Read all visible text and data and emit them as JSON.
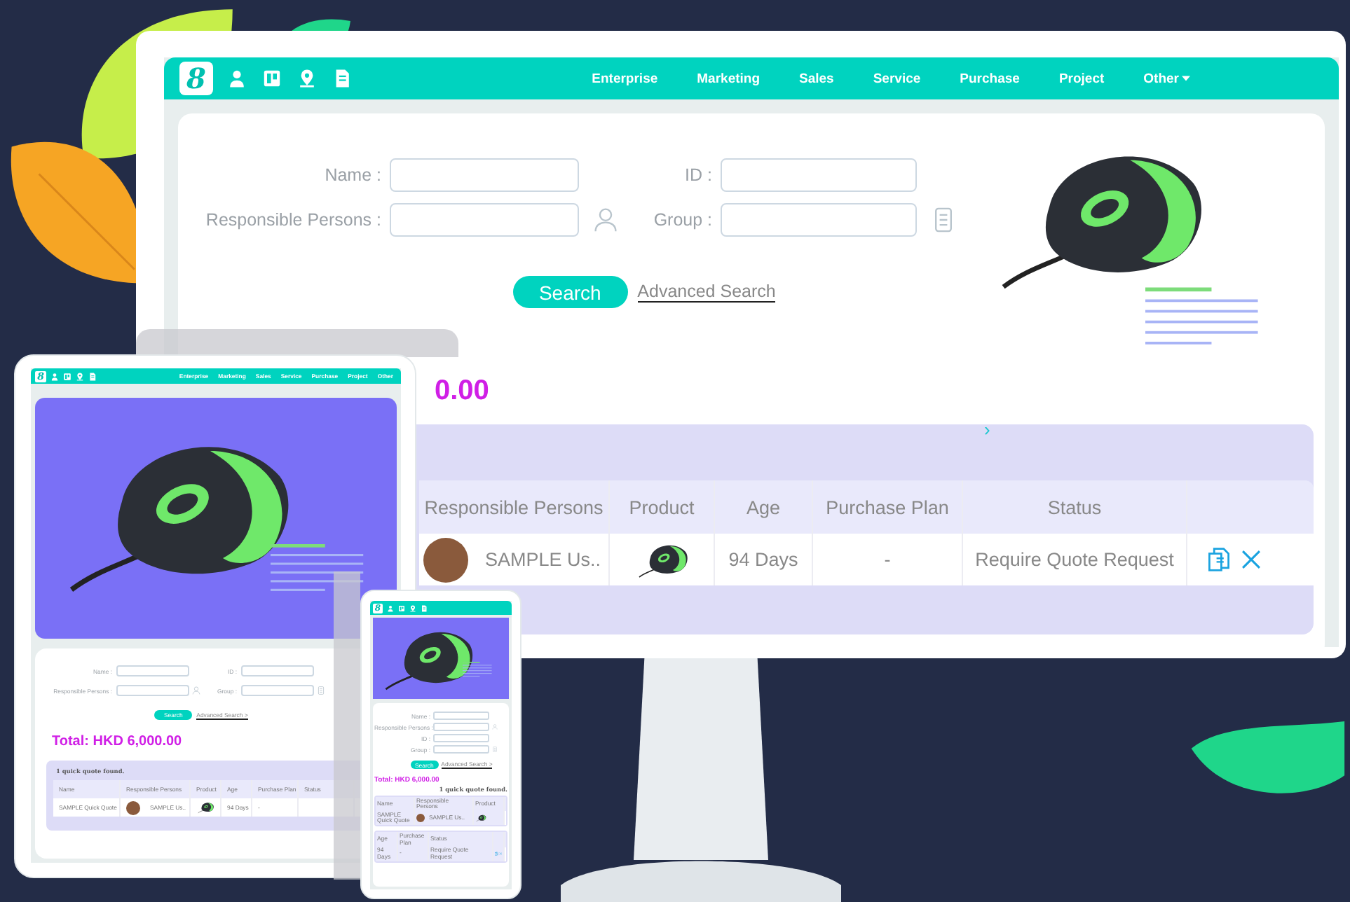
{
  "monitor": {
    "nav": {
      "logo": "8",
      "items": [
        {
          "label": "Enterprise",
          "dropdown": false
        },
        {
          "label": "Marketing",
          "dropdown": false
        },
        {
          "label": "Sales",
          "dropdown": false
        },
        {
          "label": "Service",
          "dropdown": false
        },
        {
          "label": "Purchase",
          "dropdown": false
        },
        {
          "label": "Project",
          "dropdown": false
        },
        {
          "label": "Other",
          "dropdown": true
        }
      ]
    },
    "search_form": {
      "fields": [
        {
          "label": "Name :",
          "kind": "text"
        },
        {
          "label": "ID :",
          "kind": "text"
        },
        {
          "label": "Responsible Persons :",
          "kind": "person"
        },
        {
          "label": "Group :",
          "kind": "list"
        }
      ],
      "search_button": "Search",
      "advanced_link": "Advanced Search"
    },
    "total": "0.00",
    "results": {
      "chevron": "›",
      "tables": [
        {
          "columns": [
            "Responsible Persons",
            "Product",
            "Age",
            "Purchase Plan",
            "Status"
          ],
          "actions": true,
          "rows": [
            {
              "cells": [
                {
                  "kind": "person",
                  "text": "SAMPLE Us.."
                },
                {
                  "kind": "image"
                },
                {
                  "kind": "text",
                  "text": "94 Days"
                },
                {
                  "kind": "text",
                  "text": "-"
                },
                {
                  "kind": "text",
                  "text": "Require Quote Request"
                }
              ]
            }
          ]
        }
      ]
    }
  },
  "tablet": {
    "nav": {
      "logo": "8",
      "items": [
        {
          "label": "Enterprise"
        },
        {
          "label": "Marketing"
        },
        {
          "label": "Sales"
        },
        {
          "label": "Service"
        },
        {
          "label": "Purchase"
        },
        {
          "label": "Project"
        },
        {
          "label": "Other"
        }
      ]
    },
    "search_form": {
      "fields": [
        {
          "label": "Name :",
          "kind": "text"
        },
        {
          "label": "ID :",
          "kind": "text"
        },
        {
          "label": "Responsible Persons :",
          "kind": "person"
        },
        {
          "label": "Group :",
          "kind": "list"
        }
      ],
      "search_button": "Search",
      "advanced_link": "Advanced Search >"
    },
    "total": "Total: HKD 6,000.00",
    "results": {
      "caption": "1 quick quote found.",
      "tables": [
        {
          "columns": [
            "Name",
            "Responsible Persons",
            "Product",
            "Age",
            "Purchase Plan",
            "Status"
          ],
          "rows": [
            {
              "cells": [
                {
                  "kind": "text",
                  "text": "SAMPLE Quick Quote"
                },
                {
                  "kind": "person",
                  "text": "SAMPLE Us.."
                },
                {
                  "kind": "image"
                },
                {
                  "kind": "text",
                  "text": "94 Days"
                },
                {
                  "kind": "text",
                  "text": "-"
                }
              ]
            }
          ]
        }
      ]
    }
  },
  "phone": {
    "nav": {
      "logo": "8"
    },
    "search_form": {
      "fields": [
        {
          "label": "Name :",
          "kind": "text"
        },
        {
          "label": "Responsible Persons :",
          "kind": "person"
        },
        {
          "label": "ID :",
          "kind": "text"
        },
        {
          "label": "Group :",
          "kind": "list"
        }
      ],
      "search_button": "Search",
      "advanced_link": "Advanced Search >"
    },
    "total": "Total: HKD 6,000.00",
    "results": {
      "caption": "1 quick quote found.",
      "tables": [
        {
          "columns": [
            "Name",
            "Responsible Persons",
            "Product"
          ],
          "actions": false,
          "rows": [
            {
              "cells": [
                {
                  "kind": "text",
                  "text": "SAMPLE Quick Quote"
                },
                {
                  "kind": "person",
                  "text": "SAMPLE Us.."
                },
                {
                  "kind": "image"
                }
              ]
            }
          ]
        },
        {
          "columns": [
            "Age",
            "Purchase Plan",
            "Status"
          ],
          "actions": true,
          "rows": [
            {
              "cells": [
                {
                  "kind": "text",
                  "text": "94 Days"
                },
                {
                  "kind": "text",
                  "text": "-"
                },
                {
                  "kind": "text",
                  "text": "Require Quote Request"
                }
              ]
            }
          ]
        }
      ]
    }
  }
}
